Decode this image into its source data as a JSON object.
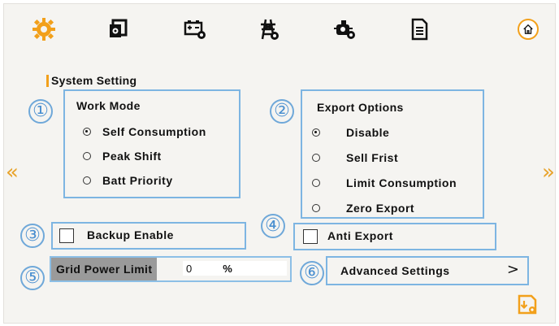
{
  "toolbar": {
    "icons": [
      "gear-icon",
      "inverter-icon",
      "battery-settings-icon",
      "grid-tower-icon",
      "generator-icon",
      "document-icon",
      "home-icon"
    ]
  },
  "colors": {
    "accent": "#f2a01b",
    "box_border": "#7db5e2",
    "number": "#4a8fd0"
  },
  "section": {
    "title": "System Setting"
  },
  "nav": {
    "prev": "«",
    "next": "»"
  },
  "work_mode": {
    "number": "①",
    "title": "Work Mode",
    "options": [
      {
        "label": "Self Consumption",
        "selected": true
      },
      {
        "label": "Peak Shift",
        "selected": false
      },
      {
        "label": "Batt Priority",
        "selected": false
      }
    ]
  },
  "export_options": {
    "number": "②",
    "title": "Export Options",
    "options": [
      {
        "label": "Disable",
        "selected": true
      },
      {
        "label": "Sell Frist",
        "selected": false
      },
      {
        "label": "Limit Consumption",
        "selected": false
      },
      {
        "label": "Zero Export",
        "selected": false
      }
    ]
  },
  "backup": {
    "number": "③",
    "label": "Backup Enable",
    "checked": false
  },
  "anti_export": {
    "number": "④",
    "label": "Anti Export",
    "checked": false
  },
  "grid_limit": {
    "number": "⑤",
    "label": "Grid Power Limit",
    "value": "0",
    "unit": "%"
  },
  "advanced": {
    "number": "⑥",
    "label": "Advanced Settings",
    "chevron": ">"
  }
}
